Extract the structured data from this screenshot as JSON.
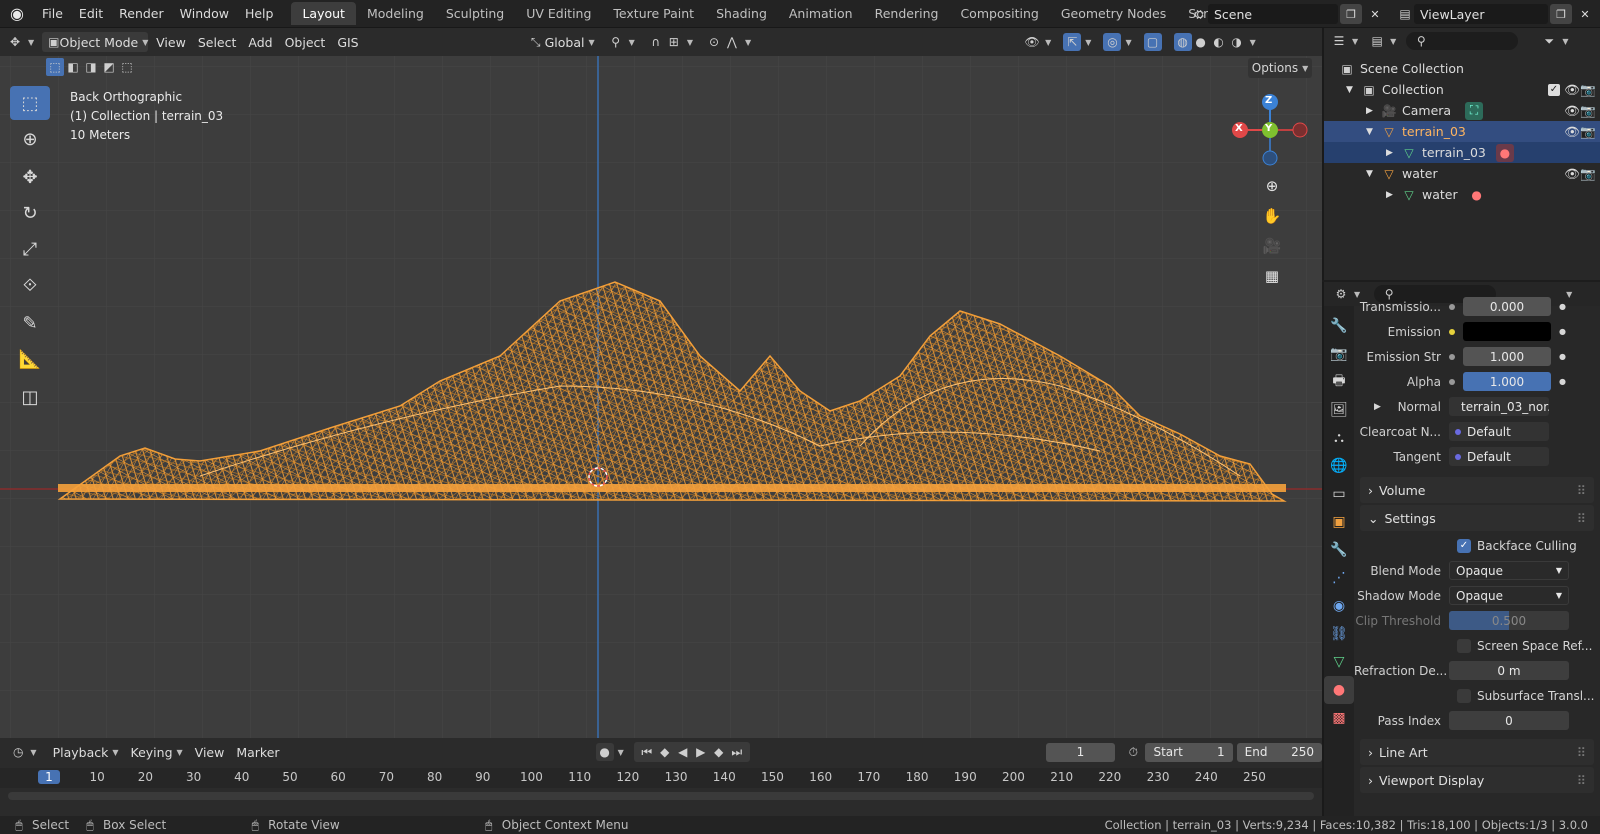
{
  "menu": [
    "File",
    "Edit",
    "Render",
    "Window",
    "Help"
  ],
  "workspaces": [
    "Layout",
    "Modeling",
    "Sculpting",
    "UV Editing",
    "Texture Paint",
    "Shading",
    "Animation",
    "Rendering",
    "Compositing",
    "Geometry Nodes",
    "Scripting"
  ],
  "active_workspace": "Layout",
  "scene_name": "Scene",
  "view_layer": "ViewLayer",
  "viewport_header": {
    "mode": "Object Mode",
    "menus": [
      "View",
      "Select",
      "Add",
      "Object",
      "GIS"
    ],
    "transform_orientation": "Global",
    "options_label": "Options"
  },
  "viewport_info": {
    "view_name": "Back Orthographic",
    "collection_line": "(1) Collection | terrain_03",
    "scale": "10 Meters"
  },
  "gizmo": {
    "z": "Z",
    "y": "Y",
    "x": "X"
  },
  "outliner": {
    "root": "Scene Collection",
    "items": [
      {
        "label": "Collection",
        "indent": 1
      },
      {
        "label": "Camera",
        "indent": 2
      },
      {
        "label": "terrain_03",
        "indent": 2,
        "selected": true
      },
      {
        "label": "terrain_03",
        "indent": 3,
        "selected": true
      },
      {
        "label": "water",
        "indent": 2
      },
      {
        "label": "water",
        "indent": 3
      }
    ]
  },
  "properties": {
    "rows": [
      {
        "label": "Transmissio...",
        "value": "0.000"
      },
      {
        "label": "Emission",
        "value": ""
      },
      {
        "label": "Emission Str",
        "value": "1.000"
      },
      {
        "label": "Alpha",
        "value": "1.000"
      },
      {
        "label": "Normal",
        "value": "terrain_03_nor..."
      },
      {
        "label": "Clearcoat N...",
        "value": "Default"
      },
      {
        "label": "Tangent",
        "value": "Default"
      }
    ],
    "panel_volume": "Volume",
    "panel_settings": "Settings",
    "backface_culling": "Backface Culling",
    "blend_mode_label": "Blend Mode",
    "blend_mode": "Opaque",
    "shadow_mode_label": "Shadow Mode",
    "shadow_mode": "Opaque",
    "clip_threshold_label": "Clip Threshold",
    "clip_threshold": "0.500",
    "screen_space": "Screen Space Ref...",
    "refraction_label": "Refraction De...",
    "refraction_value": "0 m",
    "subsurface": "Subsurface Transl...",
    "pass_index_label": "Pass Index",
    "pass_index": "0",
    "panel_line_art": "Line Art",
    "panel_viewport_display": "Viewport Display"
  },
  "timeline": {
    "menus": [
      "Playback",
      "Keying",
      "View",
      "Marker"
    ],
    "current_frame": "1",
    "start_label": "Start",
    "start": "1",
    "end_label": "End",
    "end": "250",
    "ticks": [
      "1",
      "10",
      "20",
      "30",
      "40",
      "50",
      "60",
      "70",
      "80",
      "90",
      "100",
      "110",
      "120",
      "130",
      "140",
      "150",
      "160",
      "170",
      "180",
      "190",
      "200",
      "210",
      "220",
      "230",
      "240",
      "250"
    ]
  },
  "status": {
    "select": "Select",
    "box_select": "Box Select",
    "rotate_view": "Rotate View",
    "context_menu": "Object Context Menu",
    "stats": "Collection | terrain_03 | Verts:9,234 | Faces:10,382 | Tris:18,100 | Objects:1/3 | 3.0.0"
  },
  "colors": {
    "accent": "#4772b3",
    "wire": "#f5a13b",
    "selected_row": "#334d80"
  }
}
